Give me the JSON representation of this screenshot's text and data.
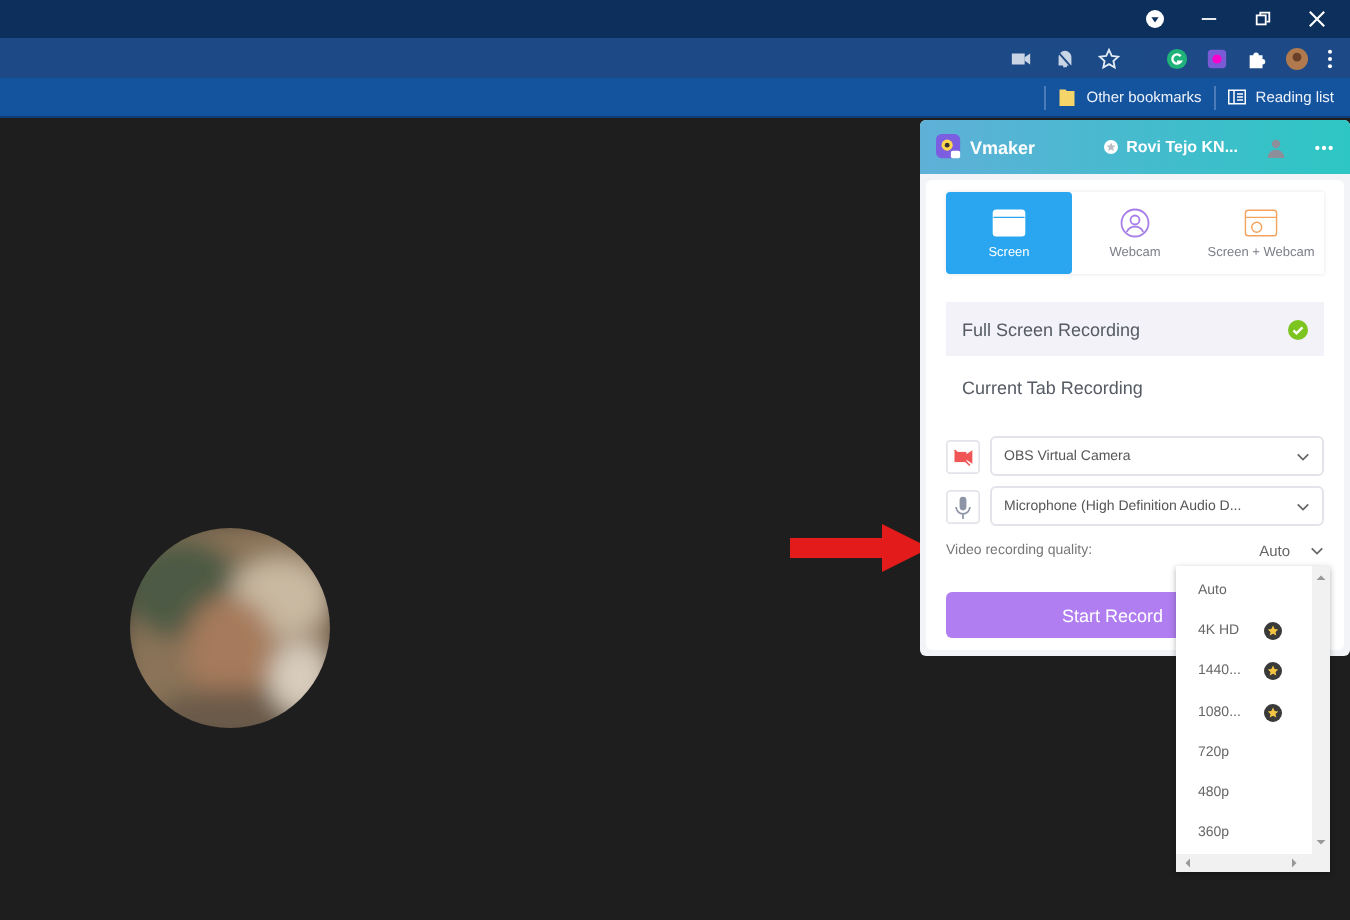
{
  "browser": {
    "bookmarks": [
      {
        "label": "Other bookmarks",
        "kind": "folder"
      },
      {
        "label": "Reading list",
        "kind": "list"
      }
    ]
  },
  "popup": {
    "brand": "Vmaker",
    "user": "Rovi Tejo KN...",
    "modes": [
      {
        "label": "Screen",
        "kind": "screen",
        "selected": true
      },
      {
        "label": "Webcam",
        "kind": "webcam",
        "selected": false
      },
      {
        "label": "Screen + Webcam",
        "kind": "both",
        "selected": false
      }
    ],
    "recording_options": [
      {
        "label": "Full Screen Recording",
        "selected": true
      },
      {
        "label": "Current Tab Recording",
        "selected": false
      }
    ],
    "camera": {
      "value": "OBS Virtual Camera"
    },
    "microphone": {
      "value": "Microphone (High Definition Audio D..."
    },
    "quality": {
      "label": "Video recording quality:",
      "value": "Auto"
    },
    "start_button": "Start Record",
    "quality_options": [
      {
        "label": "Auto",
        "premium": false
      },
      {
        "label": "4K HD",
        "premium": true
      },
      {
        "label": "1440...",
        "premium": true
      },
      {
        "label": "1080...",
        "premium": true
      },
      {
        "label": "720p",
        "premium": false
      },
      {
        "label": "480p",
        "premium": false
      },
      {
        "label": "360p",
        "premium": false
      }
    ]
  }
}
